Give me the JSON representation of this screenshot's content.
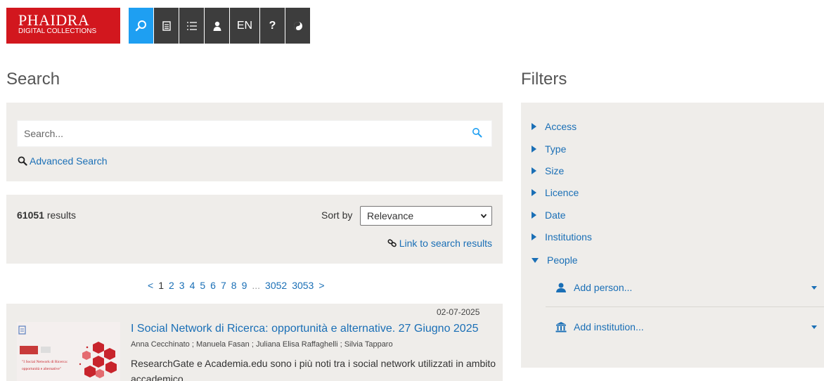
{
  "logo": {
    "line1": "PHAIDRA",
    "line2": "DIGITAL COLLECTIONS"
  },
  "nav": {
    "lang": "EN",
    "help": "?"
  },
  "search": {
    "heading": "Search",
    "placeholder": "Search...",
    "advanced": "Advanced Search"
  },
  "results": {
    "count": "61051",
    "count_suffix": " results",
    "sort_label": "Sort by",
    "sort_value": "Relevance",
    "link": "Link to search results"
  },
  "pagination": {
    "prev": "<",
    "pages": [
      "1",
      "2",
      "3",
      "4",
      "5",
      "6",
      "7",
      "8",
      "9"
    ],
    "ellipsis": "...",
    "last_pages": [
      "3052",
      "3053"
    ],
    "next": ">"
  },
  "result_item": {
    "date": "02-07-2025",
    "title": "I Social Network di Ricerca: opportunità e alternative. 27 Giugno 2025",
    "authors": "Anna Cecchinato ; Manuela Fasan ; Juliana Elisa Raffaghelli ; Silvia Tapparo",
    "abstract": "ResearchGate e Academia.edu sono i più noti tra i social network utilizzati in ambito accademico",
    "thumb_text_1": "\"I Social Network di Ricerca:",
    "thumb_text_2": "opportunità e alternative\""
  },
  "filters": {
    "heading": "Filters",
    "items": [
      "Access",
      "Type",
      "Size",
      "Licence",
      "Date",
      "Institutions",
      "People"
    ],
    "add_person": "Add person...",
    "add_institution": "Add institution..."
  },
  "colors": {
    "brand": "#d2171e",
    "accent": "#1e9ff2",
    "link": "#1a6fb6",
    "panel": "#efedea"
  }
}
